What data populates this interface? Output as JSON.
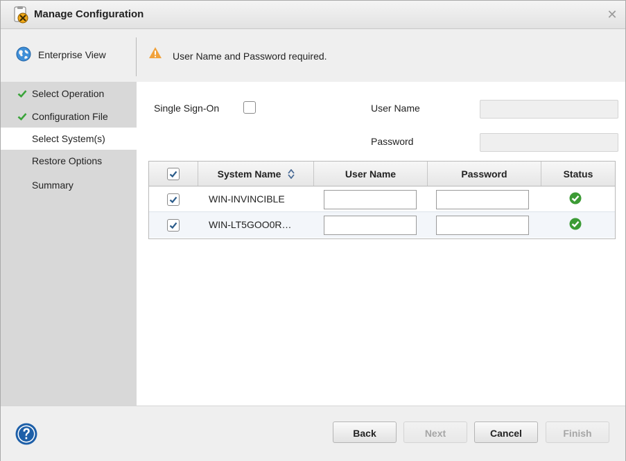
{
  "window": {
    "title": "Manage Configuration",
    "close_glyph": "✕"
  },
  "header": {
    "enterprise_view_label": "Enterprise View",
    "warning_message": "User Name and Password required."
  },
  "steps": [
    {
      "label": "Select Operation",
      "done": true
    },
    {
      "label": "Configuration File",
      "done": true
    },
    {
      "label": "Select System(s)",
      "active": true
    },
    {
      "label": "Restore Options"
    },
    {
      "label": "Summary"
    }
  ],
  "form": {
    "single_sign_on_label": "Single Sign-On",
    "single_sign_on_checked": false,
    "user_name_label": "User Name",
    "user_name_value": "",
    "password_label": "Password",
    "password_value": ""
  },
  "table": {
    "header_checked": true,
    "columns": [
      "System Name",
      "User Name",
      "Password",
      "Status"
    ],
    "rows": [
      {
        "checked": true,
        "system_name": "WIN-INVINCIBLE",
        "user_name": "",
        "password": "",
        "status": "ok"
      },
      {
        "checked": true,
        "system_name": "WIN-LT5GOO0R…",
        "user_name": "",
        "password": "",
        "status": "ok"
      }
    ]
  },
  "footer": {
    "back_label": "Back",
    "next_label": "Next",
    "cancel_label": "Cancel",
    "finish_label": "Finish"
  },
  "colors": {
    "check_green": "#3aa43a",
    "status_green": "#3c9b35",
    "warning_orange": "#f1a23c",
    "help_blue": "#1d5fa8"
  },
  "icons": [
    "config-tool-icon",
    "close-icon",
    "globe-icon",
    "warning-icon",
    "check-icon",
    "sort-icon",
    "status-ok-icon",
    "help-icon"
  ]
}
